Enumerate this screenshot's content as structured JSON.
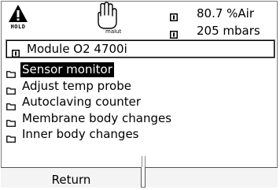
{
  "status": {
    "hold_label": "HOLD",
    "manual_label": "malut"
  },
  "readouts": [
    {
      "value": "80.7 %Air"
    },
    {
      "value": "205 mbars"
    }
  ],
  "module": {
    "label": "Module O2 4700i"
  },
  "menu": {
    "items": [
      {
        "label": "Sensor monitor"
      },
      {
        "label": "Adjust temp probe"
      },
      {
        "label": "Autoclaving counter"
      },
      {
        "label": "Membrane body changes"
      },
      {
        "label": "Inner body changes"
      }
    ],
    "selected_index": 0
  },
  "softkeys": {
    "left_label": "Return",
    "right_label": ""
  }
}
